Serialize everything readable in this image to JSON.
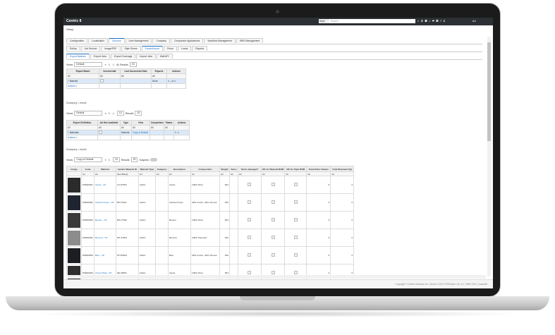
{
  "topbar": {
    "brand": "Centric 8",
    "style_select": "Style",
    "search_placeholder": "Search",
    "user": "AU"
  },
  "breadcrumb": "Setup",
  "tabs_row1": [
    "Configuration",
    "Localization",
    "Sources",
    "User Management",
    "Company",
    "Companion Applications",
    "Workflow Management",
    "RMS Management"
  ],
  "tabs_row2": [
    "Rollup",
    "Job Service",
    "Image/PDF",
    "Style Shoes",
    "Export/Import",
    "Prune",
    "Loans",
    "Reports"
  ],
  "tabs_row3": [
    "Export Batches",
    "Export Jobs",
    "Export Coverage",
    "Import Jobs",
    "Mail API"
  ],
  "toolbar1": {
    "views_label": "Views",
    "views_value": "Default",
    "results_label": "Results",
    "results_value": "20"
  },
  "batch_table": {
    "headers": [
      "Export Batch",
      "Incremental",
      "Last Successful Date",
      "Exports",
      "Actions"
    ],
    "filter": [
      "All",
      "All",
      "All",
      "All",
      ""
    ],
    "row": [
      "Material",
      "",
      "",
      "None",
      ""
    ],
    "actions_label": "Actions",
    "footer": "Displaying 1 results"
  },
  "toolbar2": {
    "views_label": "Views",
    "views_value": "Default",
    "page_value": "10",
    "results_label": "Results",
    "results_value": "20"
  },
  "def_table": {
    "headers": [
      "Export Definition",
      "Ad Hoc Available",
      "Type",
      "View",
      "Completion",
      "Status",
      "Actions"
    ],
    "filter": [
      "All",
      "All",
      "All",
      "All",
      "All",
      "All",
      ""
    ],
    "row": [
      "Materials",
      "",
      "Material",
      "Copy of Default",
      "",
      "",
      ""
    ],
    "actions_label": "Actions",
    "footer": "Displaying 1 results"
  },
  "toolbar3": {
    "views_label": "Views",
    "views_value": "Copy of Default",
    "page_value": "10",
    "results_label": "Results",
    "results_value": "20",
    "suspend_label": "Suspend"
  },
  "materials": {
    "headers": [
      "Image",
      "Code",
      "Material",
      "Vendor Material ID",
      "Material Type",
      "Category",
      "Description",
      "Composition",
      "Weight",
      "Sizes",
      "Stock managed?",
      "OK for Material BOM",
      "OK for Style BOM",
      "Total Order Volume",
      "Total Shipment Qty"
    ],
    "filter": [
      "",
      "All",
      "All",
      "(Not Blank)",
      "All",
      "All",
      "All",
      "All",
      "All",
      "All",
      "All",
      "All",
      "All",
      "All",
      "All"
    ],
    "rows": [
      {
        "code": "PM000001",
        "material": "Velvet - VP",
        "vendor_id": "CV-87603",
        "type": "Fabric",
        "category": "",
        "description": "Velvet",
        "composition": "100% Wool",
        "weight": "964",
        "volume": "0",
        "shipment": "0"
      },
      {
        "code": "PM000002",
        "material": "Admiral Crepe - VP",
        "vendor_id": "BP-57621",
        "type": "Fabric",
        "category": "",
        "description": "Admiral Crepe",
        "composition": "60% Cotton, 40% Viscose",
        "weight": "200",
        "volume": "0",
        "shipment": "0"
      },
      {
        "code": "PM000003",
        "material": "Benton - VP",
        "vendor_id": "BH-27532",
        "type": "Fabric",
        "category": "",
        "description": "Benton",
        "composition": "100% Wool",
        "weight": "964",
        "volume": "0",
        "shipment": "0"
      },
      {
        "code": "PM000004",
        "material": "Bemma - VP",
        "vendor_id": "DP-37604",
        "type": "Fabric",
        "category": "",
        "description": "Bemma",
        "composition": "100% Polyester",
        "weight": "200",
        "volume": "0",
        "shipment": "0"
      },
      {
        "code": "PM000005",
        "material": "Bleu - VP",
        "vendor_id": "HH-55523",
        "type": "Fabric",
        "category": "",
        "description": "Bleu",
        "composition": "60% Cotton, 40% Viscose",
        "weight": "200",
        "volume": "0",
        "shipment": "0"
      },
      {
        "code": "PM000006",
        "material": "Check Plaid - VP",
        "vendor_id": "SE-66553",
        "type": "Fabric",
        "category": "",
        "description": "Velvet",
        "composition": "100% Wool",
        "weight": "964",
        "volume": "0",
        "shipment": "0"
      }
    ]
  },
  "footer_text": "Copyright © Centric Software Inc.   Version: C8.9.0 SP6   Build: C8_9.0_79867-2021_ClassicM"
}
